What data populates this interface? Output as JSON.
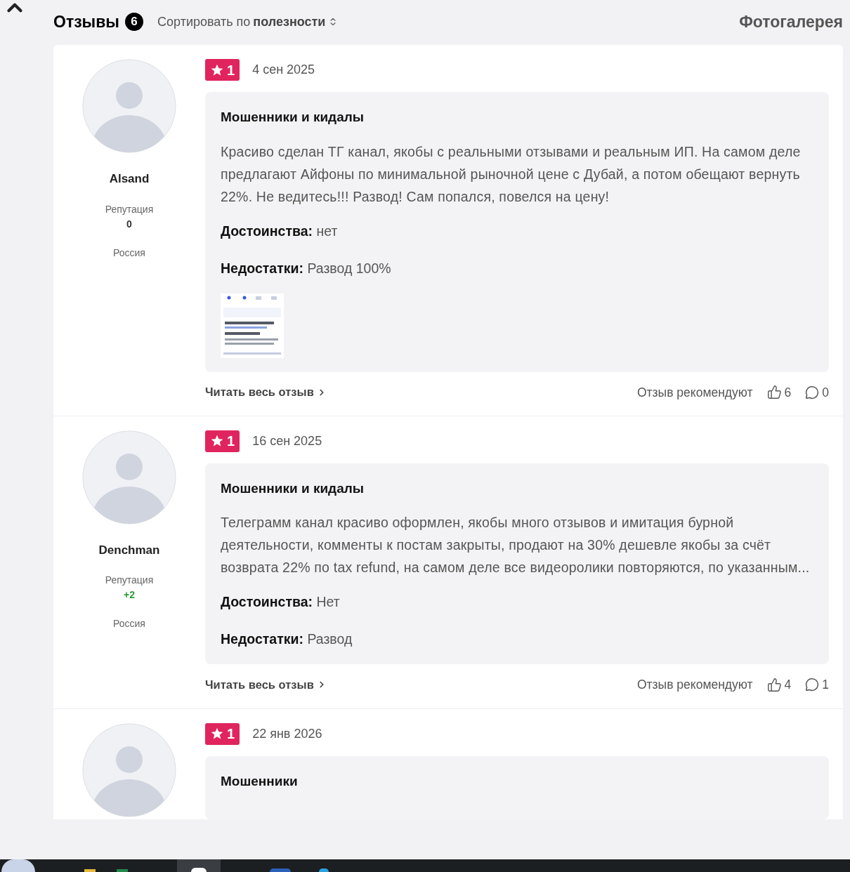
{
  "header": {
    "title": "Отзывы",
    "count": "6",
    "sort_label": "Сортировать по",
    "sort_value": "полезности",
    "gallery": "Фотогалерея"
  },
  "reviews": [
    {
      "author": "Alsand",
      "reputation_label": "Репутация",
      "reputation": "0",
      "reputation_positive": false,
      "country": "Россия",
      "rating": "1",
      "date": "4 сен 2025",
      "title": "Мошенники и кидалы",
      "text": "Красиво сделан ТГ канал, якобы с реальными отзывами и реальным ИП. На самом деле предлагают Айфоны по минимальной рыночной цене с Дубай, а потом обещают вернуть 22%. Не ведитесь!!! Развод! Сам попался, повелся на цену!",
      "pros": {
        "label": "Достоинства:",
        "value": "нет"
      },
      "cons": {
        "label": "Недостатки:",
        "value": "Развод 100%"
      },
      "read_more": "Читать весь отзыв",
      "recommend_label": "Отзыв рекомендуют",
      "likes": "6",
      "comments": "0"
    },
    {
      "author": "Denchman",
      "reputation_label": "Репутация",
      "reputation": "+2",
      "reputation_positive": true,
      "country": "Россия",
      "rating": "1",
      "date": "16 сен 2025",
      "title": "Мошенники и кидалы",
      "text": "Телеграмм канал красиво оформлен, якобы много отзывов и имитация бурной деятельности, комменты к постам закрыты, продают на 30% дешевле якобы за счёт возврата 22% по tax refund, на самом деле все видеоролики повторяются, по указанным...",
      "pros": {
        "label": "Достоинства:",
        "value": "Нет"
      },
      "cons": {
        "label": "Недостатки:",
        "value": "Развод"
      },
      "read_more": "Читать весь отзыв",
      "recommend_label": "Отзыв рекомендуют",
      "likes": "4",
      "comments": "1"
    },
    {
      "rating": "1",
      "date": "22 янв 2026",
      "title": "Мошенники"
    }
  ]
}
